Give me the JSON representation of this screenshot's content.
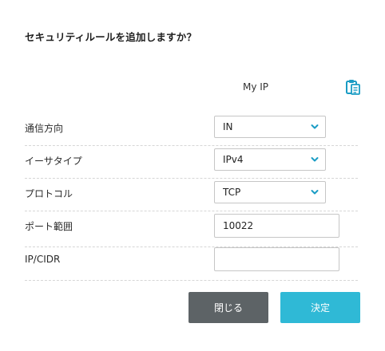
{
  "dialog": {
    "title": "セキュリティルールを追加しますか？"
  },
  "my_ip": {
    "label": "My IP",
    "icon": "clipboard-icon"
  },
  "fields": {
    "direction": {
      "label": "通信方向",
      "value": "IN"
    },
    "ether_type": {
      "label": "イーサタイプ",
      "value": "IPv4"
    },
    "protocol": {
      "label": "プロトコル",
      "value": "TCP"
    },
    "port_range": {
      "label": "ポート範囲",
      "value": "10022"
    },
    "ip_cidr": {
      "label": "IP/CIDR",
      "value": ""
    }
  },
  "buttons": {
    "close_label": "閉じる",
    "confirm_label": "決定"
  },
  "colors": {
    "accent": "#2fb9d6",
    "close_button": "#5d6366",
    "icon": "#1a9cc4"
  }
}
